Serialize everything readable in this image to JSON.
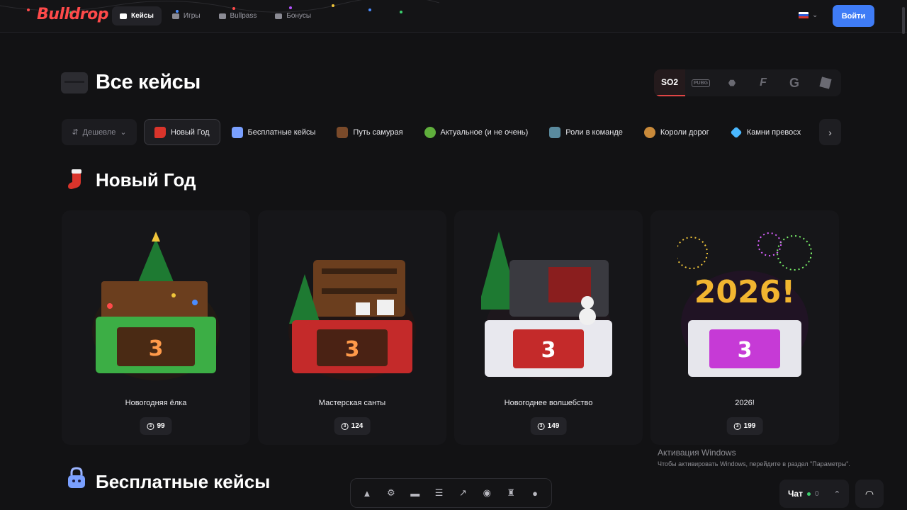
{
  "header": {
    "logo": "Bulldrop",
    "nav": [
      {
        "label": "Кейсы",
        "icon": "cases-icon",
        "active": true
      },
      {
        "label": "Игры",
        "icon": "gamepad-icon",
        "active": false
      },
      {
        "label": "Bullpass",
        "icon": "ticket-icon",
        "active": false
      },
      {
        "label": "Бонусы",
        "icon": "gift-icon",
        "active": false
      }
    ],
    "language_icon": "flag-ru-icon",
    "login_label": "Войти",
    "accent_color": "#3f7cf6",
    "brand_color": "#ff4a4a"
  },
  "page": {
    "title": "Все кейсы",
    "games": [
      "SO2",
      "PUBG",
      "Standoff",
      "Free Fire",
      "G",
      "Roblox"
    ],
    "games_active": "SO2"
  },
  "filters": {
    "sort_label": "Дешевле",
    "categories": [
      {
        "label": "Новый Год",
        "icon": "stocking-icon",
        "active": true
      },
      {
        "label": "Бесплатные кейсы",
        "icon": "lock-icon",
        "active": false
      },
      {
        "label": "Путь самурая",
        "icon": "samurai-icon",
        "active": false
      },
      {
        "label": "Актуальное (и не очень)",
        "icon": "frog-icon",
        "active": false
      },
      {
        "label": "Роли в команде",
        "icon": "puzzle-icon",
        "active": false
      },
      {
        "label": "Короли дорог",
        "icon": "wheel-icon",
        "active": false
      },
      {
        "label": "Камни превосх",
        "icon": "diamond-icon",
        "active": false
      }
    ]
  },
  "sections": [
    {
      "title": "Новый Год",
      "icon": "stocking-icon",
      "cards": [
        {
          "name": "Новогодняя ёлка",
          "price": "99",
          "color": "#3cae45"
        },
        {
          "name": "Мастерская санты",
          "price": "124",
          "color": "#c42a2a"
        },
        {
          "name": "Новогоднее волшебство",
          "price": "149",
          "color": "#d83a3a"
        },
        {
          "name": "2026!",
          "price": "199",
          "color": "#c63ad6"
        }
      ]
    },
    {
      "title": "Бесплатные кейсы",
      "icon": "lock-icon"
    }
  ],
  "watermark": {
    "title": "Активация Windows",
    "subtitle": "Чтобы активировать Windows, перейдите в раздел \"Параметры\"."
  },
  "dock": [
    "navigation-icon",
    "settings-icon",
    "chat-bubble-icon",
    "list-icon",
    "chart-icon",
    "globe-icon",
    "rook-icon",
    "bomb-icon"
  ],
  "chat": {
    "label": "Чат",
    "count": "0"
  }
}
